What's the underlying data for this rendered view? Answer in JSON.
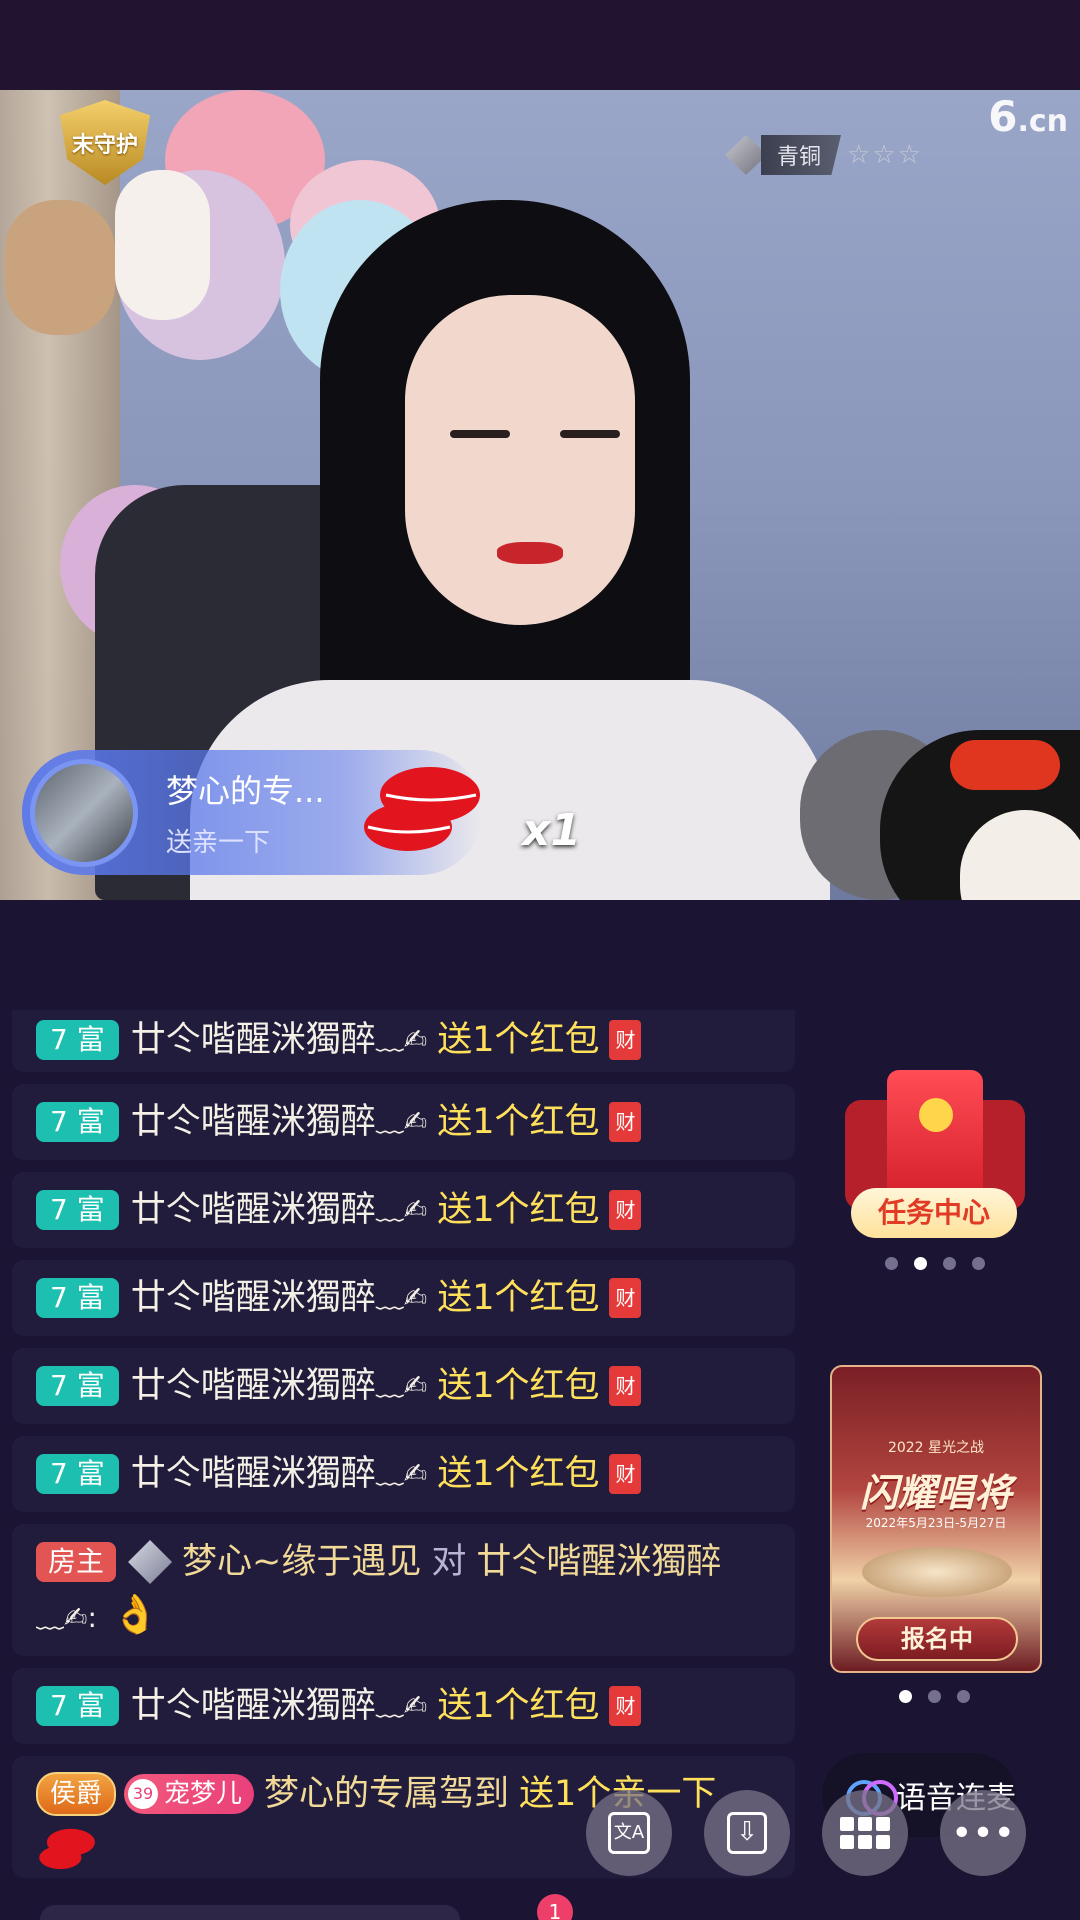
{
  "video": {
    "guard_badge": "末守护",
    "rank_label": "青铜",
    "rank_stars": "☆☆☆",
    "logo_main": "6",
    "logo_tld": ".cn"
  },
  "gift_banner": {
    "name": "梦心的专...",
    "action": "送亲一下",
    "combo": "x1"
  },
  "chat": {
    "messages": [
      {
        "badge": "7 富",
        "user": "廿仒喈醒洣獨醉",
        "pen": "﹏✍",
        "gift": "送1个红包",
        "icon": "财"
      },
      {
        "badge": "7 富",
        "user": "廿仒喈醒洣獨醉",
        "pen": "﹏✍",
        "gift": "送1个红包",
        "icon": "财"
      },
      {
        "badge": "7 富",
        "user": "廿仒喈醒洣獨醉",
        "pen": "﹏✍",
        "gift": "送1个红包",
        "icon": "财"
      },
      {
        "badge": "7 富",
        "user": "廿仒喈醒洣獨醉",
        "pen": "﹏✍",
        "gift": "送1个红包",
        "icon": "财"
      },
      {
        "badge": "7 富",
        "user": "廿仒喈醒洣獨醉",
        "pen": "﹏✍",
        "gift": "送1个红包",
        "icon": "财"
      },
      {
        "badge": "7 富",
        "user": "廿仒喈醒洣獨醉",
        "pen": "﹏✍",
        "gift": "送1个红包",
        "icon": "财"
      },
      {
        "badge": "7 富",
        "user": "廿仒喈醒洣獨醉",
        "pen": "﹏✍",
        "gift": "送1个红包",
        "icon": "财"
      }
    ],
    "host_msg": {
      "badge": "房主",
      "user": "梦心~缘于遇见",
      "to": "对",
      "target": "廿仒喈醒洣獨醉",
      "tail": "﹏✍:",
      "emoji": "👌"
    },
    "marquis_msg": {
      "badge": "侯爵",
      "fan_level": "39",
      "fan_name": "宠梦儿",
      "user": "梦心的专属驾到",
      "gift": "送1个亲一下"
    }
  },
  "side": {
    "task_label": "任务中心",
    "promo_year": "2022 星光之战",
    "promo_title": "闪耀唱将",
    "promo_date": "2022年5月23日-5月27日",
    "promo_button": "报名中"
  },
  "toolbar": {
    "voice_label": "语音连麦",
    "translate_glyph": "文A",
    "download_glyph": "⇩",
    "more_glyph": "•••",
    "notification_count": "1"
  }
}
